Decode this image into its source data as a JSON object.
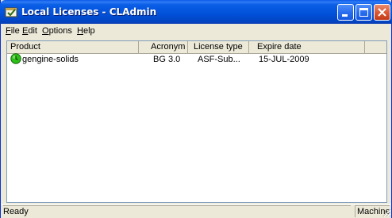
{
  "window": {
    "title": "Local Licenses - CLAdmin"
  },
  "menu": {
    "items": [
      "File",
      "Edit",
      "Options",
      "Help"
    ]
  },
  "table": {
    "columns": [
      "Product",
      "Acronym",
      "License type",
      "Expire date"
    ],
    "rows": [
      {
        "product": "gengine-solids",
        "acronym": "BG 3.0",
        "license_type": "ASF-Sub...",
        "expire_date": "15-JUL-2009",
        "icon": "green-clock-icon"
      }
    ]
  },
  "status": {
    "left": "Ready",
    "right": "Machine"
  },
  "colors": {
    "title_bar": "#0250d8",
    "window_frame": "#ece9d8",
    "close_button": "#dc5a36",
    "product_icon": "#2fbf1a"
  }
}
